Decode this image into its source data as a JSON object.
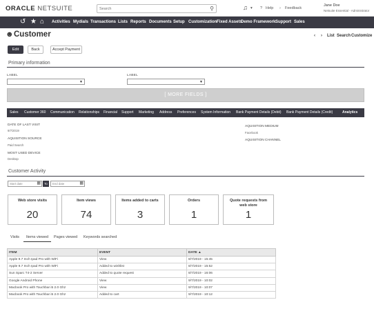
{
  "brand": {
    "name_bold": "ORACLE",
    "name_light": "NETSUITE"
  },
  "search": {
    "placeholder": "Search"
  },
  "topbar": {
    "help_label": "Help",
    "feedback_label": "Feedback"
  },
  "user": {
    "name": "Jane Doe",
    "role": "Netsuite Essential - Administrator"
  },
  "nav": {
    "items": [
      "Activities",
      "Mydials",
      "Transactions",
      "Lists",
      "Reports",
      "Documents",
      "Setup",
      "Customization",
      "Fixed Assets",
      "Demo Framework",
      "Support",
      "Sales"
    ]
  },
  "page": {
    "title": "Customer"
  },
  "record_nav": {
    "list_label": "List",
    "search_label": "Search",
    "customize_label": "Customize"
  },
  "actions": {
    "edit_label": "Edit",
    "back_label": "Back",
    "accept_payment_label": "Accept Payment"
  },
  "primary_info": {
    "title": "Primary information",
    "label_1": "LABEL",
    "label_2": "LABEL",
    "more_fields_label": "[ MORE FIELDS ]"
  },
  "subtabs": {
    "items": [
      "Sales",
      "Customer 360",
      "Communication",
      "Relationships",
      "Financial",
      "Support",
      "Marketing",
      "Address",
      "Preferences",
      "System Information",
      "Bank Payment Details (Debit)",
      "Bank Payment Details (Credit)",
      "Analytics"
    ],
    "active": "Analytics"
  },
  "analytics": {
    "date_of_last_visit_label": "DATE OF LAST VISIT",
    "date_of_last_visit_value": "9/7/2019",
    "acquisition_source_label": "AQUISITION SOURCE",
    "acquisition_source_value": "Paid Search",
    "most_used_device_label": "MOST USED DEVICE",
    "most_used_device_value": "Desktop",
    "acquisition_medium_label": "AQUISITION MEDIUM",
    "acquisition_medium_value": "Facebook",
    "acquisition_channel_label": "AQUISITION CHANNEL"
  },
  "customer_activity": {
    "title": "Customer Activity",
    "start_date_placeholder": "Start date",
    "to_label": "To",
    "end_date_placeholder": "End date",
    "cards": [
      {
        "title": "Web store visits",
        "value": "20"
      },
      {
        "title": "Item views",
        "value": "74"
      },
      {
        "title": "Items added to carts",
        "value": "3"
      },
      {
        "title": "Orders",
        "value": "1"
      },
      {
        "title": "Quote requests from web store",
        "value": "1"
      }
    ],
    "tabs": [
      "Visits",
      "Items viewed",
      "Pages viewed",
      "Keywords searched"
    ],
    "active_tab": "Items viewed",
    "table": {
      "headers": [
        "ITEM",
        "EVENT",
        "DATE ▲"
      ],
      "rows": [
        [
          "Apple 9.7 Inch Ipad Pro with WiFi",
          "View",
          "8/7/2019 - 15:45"
        ],
        [
          "Apple 9.7 Inch Ipad Pro with WiFi",
          "Added to wishlist",
          "8/7/2019 - 15:52"
        ],
        [
          "Sun Sparc T4-2 Server",
          "Added to quote request",
          "8/7/2019 - 16:06"
        ],
        [
          "Google Android Phone",
          "View",
          "9/7/2019 - 10:02"
        ],
        [
          "Macbook Pro with Touchbar i5 2.0 Ghz",
          "View",
          "9/7/2019 - 10:07"
        ],
        [
          "Macbook Pro with Touchbar i5 2.0 Ghz",
          "Added to cart",
          "9/7/2019 - 10:12"
        ]
      ]
    }
  }
}
